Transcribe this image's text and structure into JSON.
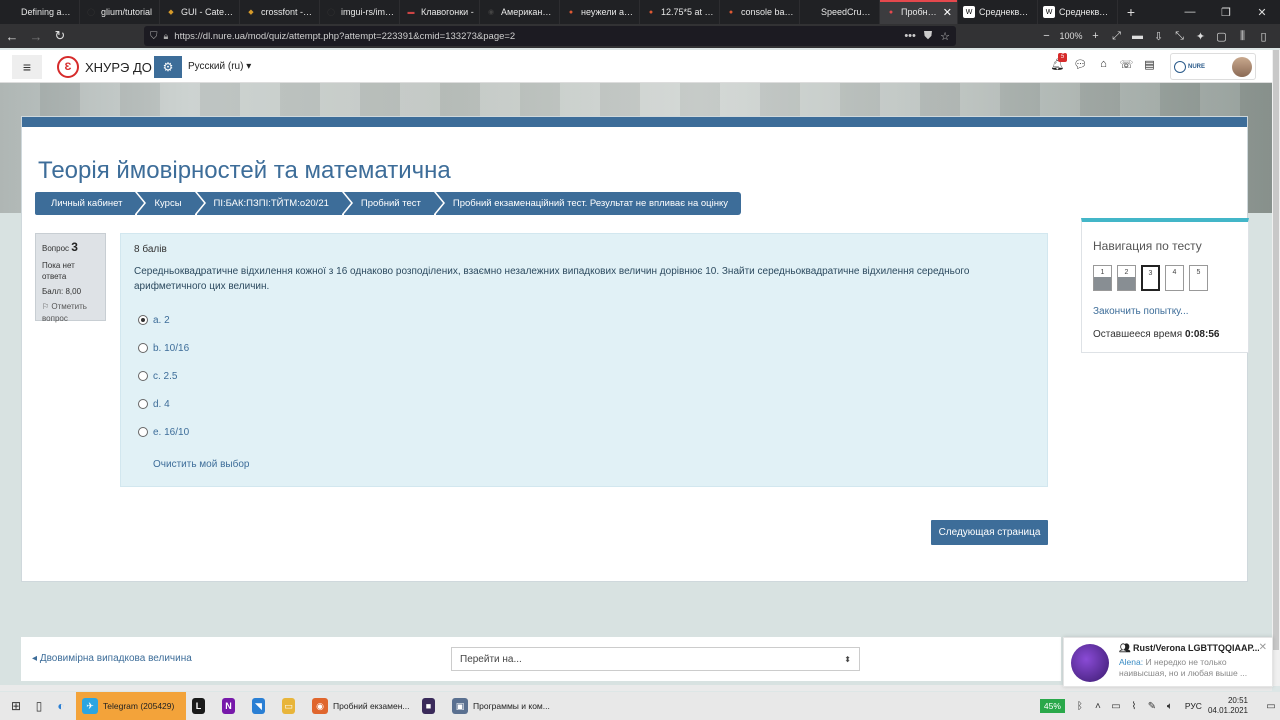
{
  "browser": {
    "tabs": [
      {
        "label": "Defining an En",
        "color": "#5a5a5a",
        "glyph": ""
      },
      {
        "label": "glium/tutorial",
        "color": "#333",
        "glyph": "◯"
      },
      {
        "label": "GUI - Categori",
        "color": "#d69a2a",
        "glyph": "◆"
      },
      {
        "label": "crossfont - cra",
        "color": "#d69a2a",
        "glyph": "◆"
      },
      {
        "label": "imgui-rs/imgu",
        "color": "#333",
        "glyph": "◯"
      },
      {
        "label": "Клавогонки -",
        "color": "#c44",
        "glyph": "▬"
      },
      {
        "label": "Американский",
        "color": "#444",
        "glyph": "◉"
      },
      {
        "label": "неужели at Du",
        "color": "#de5833",
        "glyph": "●"
      },
      {
        "label": "12.75*5 at Duc",
        "color": "#de5833",
        "glyph": "●"
      },
      {
        "label": "console based",
        "color": "#de5833",
        "glyph": "●"
      },
      {
        "label": "SpeedCrunch",
        "color": "#333",
        "glyph": ""
      },
      {
        "label": "Пробний е",
        "color": "#e5484d",
        "glyph": "●"
      },
      {
        "label": "Среднеквадр",
        "color": "#fff",
        "glyph": "W"
      },
      {
        "label": "Среднеквадр",
        "color": "#fff",
        "glyph": "W"
      }
    ],
    "active_tab_index": 11,
    "new_tab_icon": "+",
    "url": "https://dl.nure.ua/mod/quiz/attempt.php?attempt=223391&cmid=133273&page=2",
    "zoom": "100%"
  },
  "header": {
    "site_name": "ХНУРЭ ДО",
    "logo_glyph": "Ɛ",
    "language": "Русский (ru)",
    "notification_count": "5"
  },
  "course": {
    "title": "Теорія ймовірностей та математична",
    "breadcrumb": [
      "Личный кабинет",
      "Курсы",
      "ПІ:БАК:ПЗПІ:ТЙТМ:о20/21",
      "Пробний тест",
      "Пробний екзаменаційний тест. Результат не впливає на оцінку"
    ]
  },
  "question_info": {
    "label": "Вопрос",
    "number": "3",
    "status": "Пока нет ответа",
    "grade": "Балл: 8,00",
    "flag_label": "Отметить вопрос"
  },
  "question": {
    "points": "8 балів",
    "text": "Середньоквадратичне відхилення кожної з 16 однаково розподілених, взаємно незалежних випадкових величин дорівнює 10. Знайти середньоквадратичне відхилення середнього арифметичного цих величин.",
    "answers": [
      {
        "label": "a. 2",
        "checked": true
      },
      {
        "label": "b. 10/16",
        "checked": false
      },
      {
        "label": "c. 2.5",
        "checked": false
      },
      {
        "label": "d. 4",
        "checked": false
      },
      {
        "label": "e. 16/10",
        "checked": false
      }
    ],
    "clear_label": "Очистить мой выбор"
  },
  "next_button": "Следующая страница",
  "quiz_nav": {
    "title": "Навигация по тесту",
    "buttons": [
      {
        "label": "1",
        "state": "answered"
      },
      {
        "label": "2",
        "state": "answered"
      },
      {
        "label": "3",
        "state": "current"
      },
      {
        "label": "4",
        "state": "empty"
      },
      {
        "label": "5",
        "state": "empty"
      }
    ],
    "finish_label": "Закончить попытку...",
    "time_label": "Оставшееся время",
    "time_value": "0:08:56"
  },
  "footer_nav": {
    "prev_link": "Двовимірна випадкова величина",
    "jump_placeholder": "Перейти на..."
  },
  "notification": {
    "title": "Rust/Verona LGBTTQQIAAP...",
    "sender": "Alena:",
    "message": " И нередко не только наивысшая, но и любая выше ..."
  },
  "taskbar": {
    "apps": [
      {
        "label": "Telegram (205429)",
        "color": "#2ca5e0",
        "glyph": "✈",
        "highlight": true
      },
      {
        "label": "",
        "color": "#1a1a1a",
        "glyph": "L",
        "highlight": false
      },
      {
        "label": "",
        "color": "#7719aa",
        "glyph": "N",
        "highlight": false
      },
      {
        "label": "",
        "color": "#2a7fd4",
        "glyph": "◥",
        "highlight": false
      },
      {
        "label": "",
        "color": "#e8b53a",
        "glyph": "▭",
        "highlight": false
      },
      {
        "label": "Пробний екзамен...",
        "color": "#e0662d",
        "glyph": "◉",
        "highlight": false
      },
      {
        "label": "",
        "color": "#3a2a5a",
        "glyph": "■",
        "highlight": false
      },
      {
        "label": "Программы и ком...",
        "color": "#5a7090",
        "glyph": "▣",
        "highlight": false
      }
    ],
    "battery": "45%",
    "language": "РУС",
    "time": "20:51",
    "date": "04.01.2021"
  }
}
